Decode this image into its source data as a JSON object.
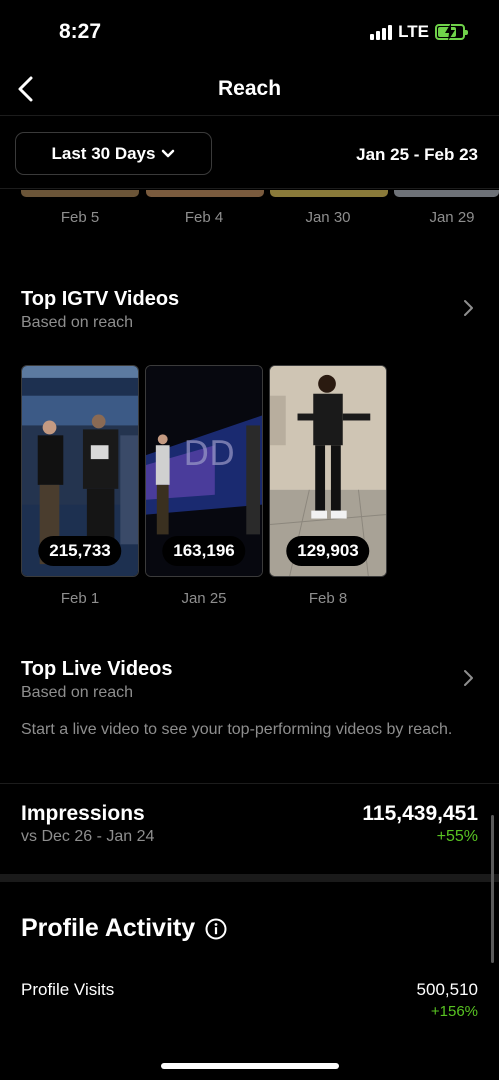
{
  "status_bar": {
    "time": "8:27",
    "network": "LTE",
    "battery_level": 0.75
  },
  "nav": {
    "title": "Reach",
    "back_icon": "chevron-left-icon"
  },
  "filter": {
    "range_label": "Last 30 Days",
    "date_range": "Jan 25 - Feb 23"
  },
  "strip": {
    "dates": [
      "Feb 5",
      "Feb 4",
      "Jan 30",
      "Jan 29"
    ]
  },
  "igtv": {
    "title": "Top IGTV Videos",
    "subtitle": "Based on reach",
    "videos": [
      {
        "count": "215,733",
        "date": "Feb 1"
      },
      {
        "count": "163,196",
        "date": "Jan 25"
      },
      {
        "count": "129,903",
        "date": "Feb 8"
      }
    ]
  },
  "live": {
    "title": "Top Live Videos",
    "subtitle": "Based on reach",
    "description": "Start a live video to see your top-performing videos by reach."
  },
  "impressions": {
    "title": "Impressions",
    "comparison": "vs Dec 26 - Jan 24",
    "value": "115,439,451",
    "change": "+55%"
  },
  "profile_activity": {
    "title": "Profile Activity",
    "visits_label": "Profile Visits",
    "visits_value": "500,510",
    "visits_change": "+156%"
  },
  "colors": {
    "background": "#000000",
    "muted": "#8e8e8e",
    "positive": "#58c322"
  }
}
